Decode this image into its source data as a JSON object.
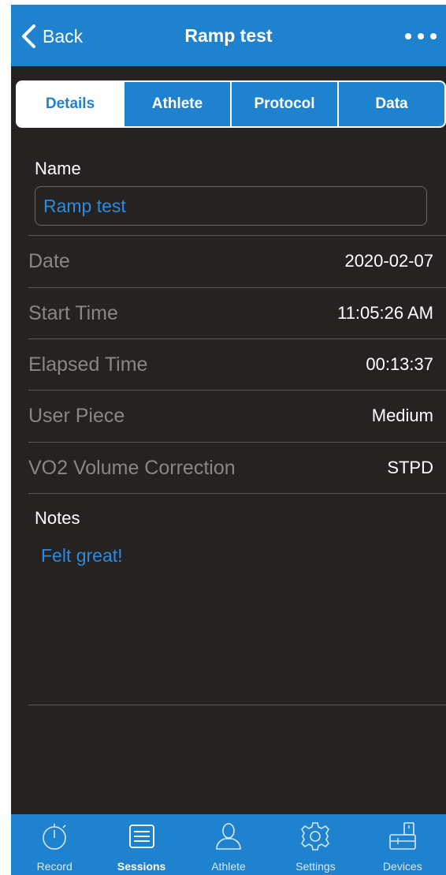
{
  "navbar": {
    "back_label": "Back",
    "title": "Ramp test",
    "more_icon": "more-horizontal-icon",
    "color": "#1f82cf"
  },
  "segments": [
    {
      "label": "Details",
      "active": true
    },
    {
      "label": "Athlete",
      "active": false
    },
    {
      "label": "Protocol",
      "active": false
    },
    {
      "label": "Data",
      "active": false
    }
  ],
  "details": {
    "name_label": "Name",
    "name_value": "Ramp test",
    "rows": [
      {
        "label": "Date",
        "value": "2020-02-07"
      },
      {
        "label": "Start Time",
        "value": "11:05:26 AM"
      },
      {
        "label": "Elapsed Time",
        "value": "00:13:37"
      },
      {
        "label": "User Piece",
        "value": "Medium"
      },
      {
        "label": "VO2 Volume Correction",
        "value": "STPD"
      }
    ],
    "notes_label": "Notes",
    "notes_value": "Felt great!"
  },
  "tabbar": {
    "items": [
      {
        "label": "Record",
        "icon": "stopwatch-icon",
        "active": false
      },
      {
        "label": "Sessions",
        "icon": "list-icon",
        "active": true
      },
      {
        "label": "Athlete",
        "icon": "person-icon",
        "active": false
      },
      {
        "label": "Settings",
        "icon": "gear-icon",
        "active": false
      },
      {
        "label": "Devices",
        "icon": "device-icon",
        "active": false
      }
    ]
  }
}
